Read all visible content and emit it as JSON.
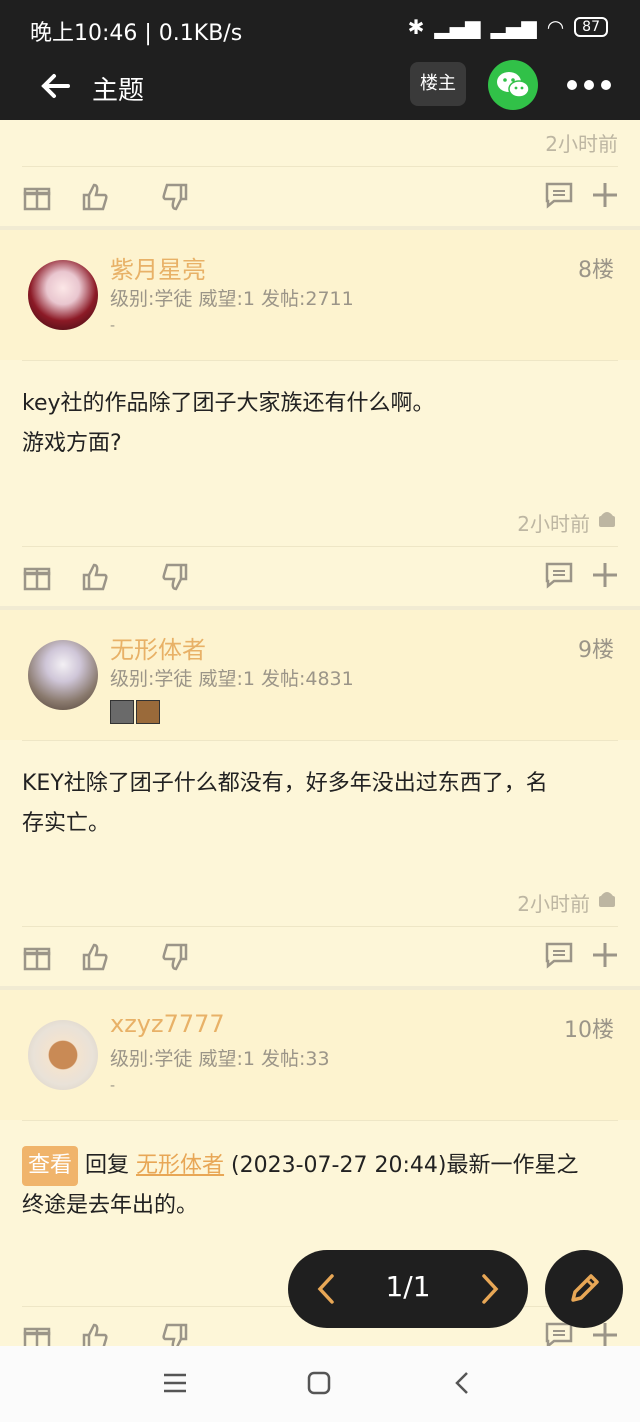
{
  "status_bar": {
    "time": "晚上10:46 | 0.1KB/s",
    "battery": "87"
  },
  "header": {
    "title": "主题",
    "louzhu_label": "楼主"
  },
  "top_partial": {
    "time": "2小时前"
  },
  "posts": [
    {
      "username": "紫月星亮",
      "meta": "级别:学徒  威望:1  发帖:2711",
      "dash": "-",
      "floor": "8楼",
      "body_line1": "key社的作品除了团子大家族还有什么啊。",
      "body_line2": "游戏方面?",
      "time": "2小时前"
    },
    {
      "username": "无形体者",
      "meta": "级别:学徒  威望:1  发帖:4831",
      "floor": "9楼",
      "body_line1": "KEY社除了团子什么都没有，好多年没出过东西了，名",
      "body_line2": "存实亡。",
      "time": "2小时前"
    },
    {
      "username": "xzyz7777",
      "meta": "级别:学徒  威望:1  发帖:33",
      "dash": "-",
      "floor": "10楼",
      "view_label": "查看",
      "reply_label": "回复",
      "reply_user": "无形体者",
      "body_rest": "(2023-07-27 20:44)最新一作星之",
      "body_line2": "终途是去年出的。"
    }
  ],
  "pager": {
    "text": "1/1"
  }
}
